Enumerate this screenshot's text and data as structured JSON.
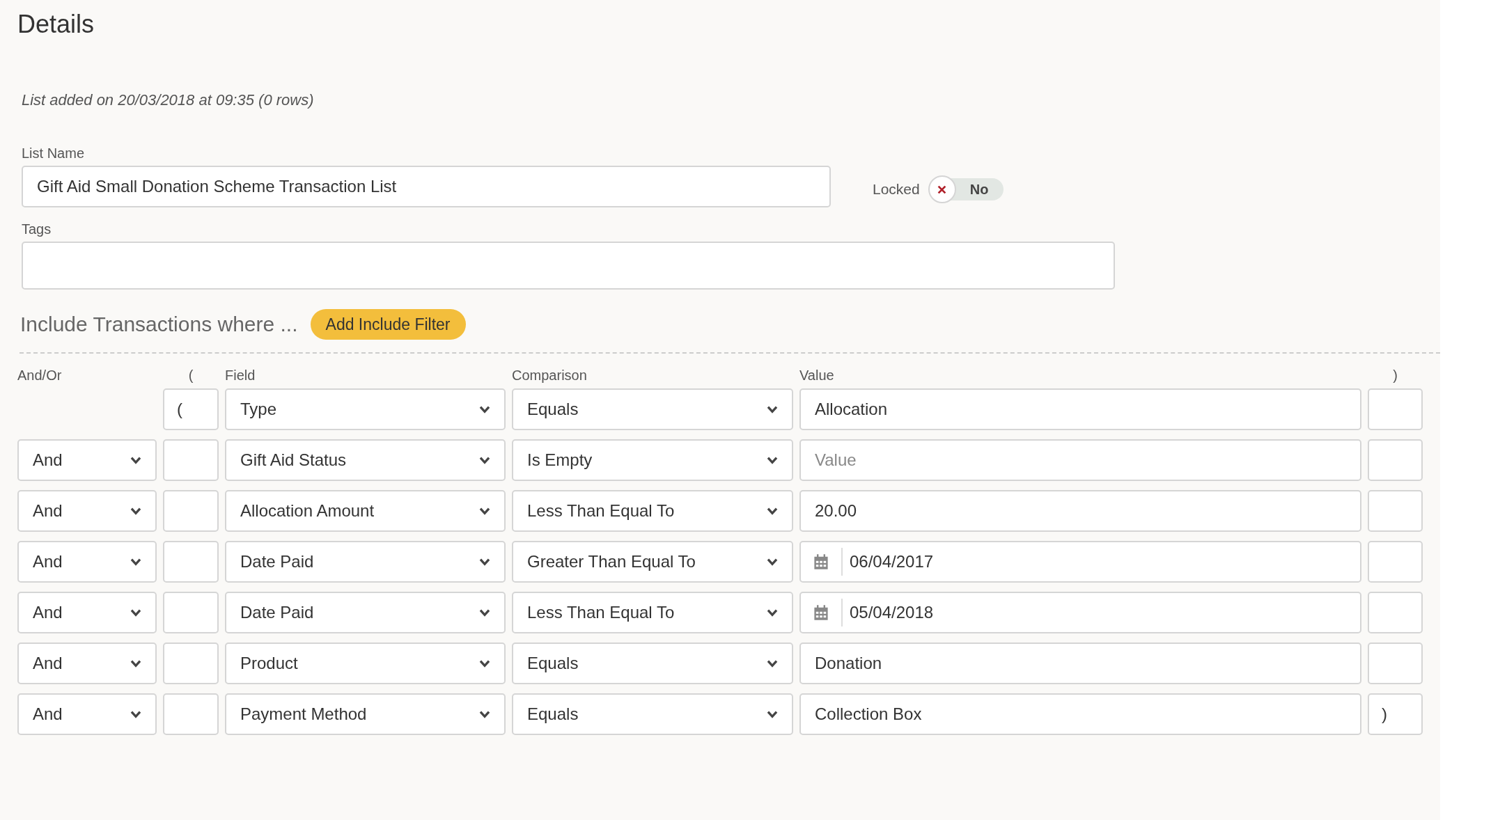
{
  "title": "Details",
  "info": "List added on 20/03/2018 at 09:35 (0 rows)",
  "list_name": {
    "label": "List Name",
    "value": "Gift Aid Small Donation Scheme Transaction List"
  },
  "locked": {
    "label": "Locked",
    "on": false,
    "text": "No"
  },
  "tags": {
    "label": "Tags"
  },
  "include": {
    "heading": "Include Transactions where ...",
    "button": "Add Include Filter"
  },
  "columns": [
    "And/Or",
    "(",
    "Field",
    "Comparison",
    "Value",
    ")"
  ],
  "filters": [
    {
      "open": "(",
      "field": "Type",
      "comparison": "Equals",
      "value": {
        "kind": "text",
        "value": "Allocation"
      }
    },
    {
      "and_or": "And",
      "field": "Gift Aid Status",
      "comparison": "Is Empty",
      "value": {
        "kind": "text",
        "placeholder": "Value"
      }
    },
    {
      "and_or": "And",
      "field": "Allocation Amount",
      "comparison": "Less Than Equal To",
      "value": {
        "kind": "text",
        "value": "20.00"
      }
    },
    {
      "and_or": "And",
      "field": "Date Paid",
      "comparison": "Greater Than Equal To",
      "value": {
        "kind": "date",
        "value": "06/04/2017"
      }
    },
    {
      "and_or": "And",
      "field": "Date Paid",
      "comparison": "Less Than Equal To",
      "value": {
        "kind": "date",
        "value": "05/04/2018"
      }
    },
    {
      "and_or": "And",
      "field": "Product",
      "comparison": "Equals",
      "value": {
        "kind": "text",
        "value": "Donation"
      }
    },
    {
      "and_or": "And",
      "field": "Payment Method",
      "comparison": "Equals",
      "value": {
        "kind": "text",
        "value": "Collection Box"
      },
      "close": ")"
    }
  ]
}
